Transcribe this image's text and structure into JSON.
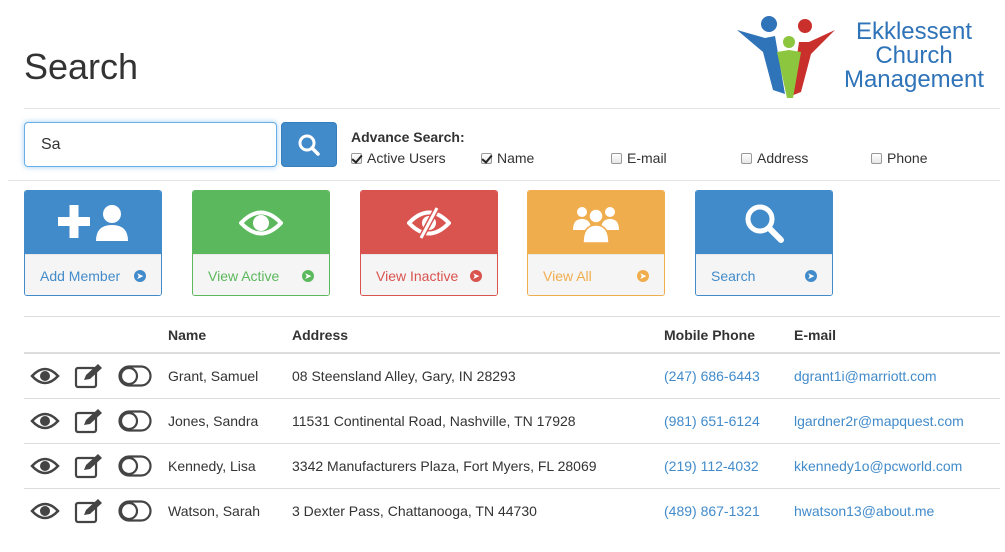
{
  "page": {
    "title": "Search"
  },
  "logo": {
    "line1": "Ekklessent",
    "line2": "Church",
    "line3": "Management"
  },
  "search": {
    "value": "Sa",
    "button_icon": "search-icon"
  },
  "advance": {
    "label": "Advance Search:",
    "options": [
      {
        "label": "Active Users",
        "checked": true
      },
      {
        "label": "Name",
        "checked": true
      },
      {
        "label": "E-mail",
        "checked": false
      },
      {
        "label": "Address",
        "checked": false
      },
      {
        "label": "Phone",
        "checked": false
      }
    ]
  },
  "tiles": [
    {
      "label": "Add Member",
      "icon": "user-plus-icon",
      "color": "#428bca"
    },
    {
      "label": "View Active",
      "icon": "eye-icon",
      "color": "#5cb85c"
    },
    {
      "label": "View Inactive",
      "icon": "eye-slash-icon",
      "color": "#d9534f"
    },
    {
      "label": "View All",
      "icon": "users-icon",
      "color": "#f0ad4e"
    },
    {
      "label": "Search",
      "icon": "search-icon",
      "color": "#428bca"
    }
  ],
  "table": {
    "headers": [
      "",
      "Name",
      "Address",
      "Mobile Phone",
      "E-mail"
    ],
    "rows": [
      {
        "name": "Grant, Samuel",
        "address": "08 Steensland Alley, Gary, IN 28293",
        "phone": "(247) 686-6443",
        "email": "dgrant1i@marriott.com"
      },
      {
        "name": "Jones, Sandra",
        "address": "11531 Continental Road, Nashville, TN 17928",
        "phone": "(981) 651-6124",
        "email": "lgardner2r@mapquest.com"
      },
      {
        "name": "Kennedy, Lisa",
        "address": "3342 Manufacturers Plaza, Fort Myers, FL 28069",
        "phone": "(219) 112-4032",
        "email": "kkennedy1o@pcworld.com"
      },
      {
        "name": "Watson, Sarah",
        "address": "3 Dexter Pass, Chattanooga, TN 44730",
        "phone": "(489) 867-1321",
        "email": "hwatson13@about.me"
      }
    ]
  }
}
